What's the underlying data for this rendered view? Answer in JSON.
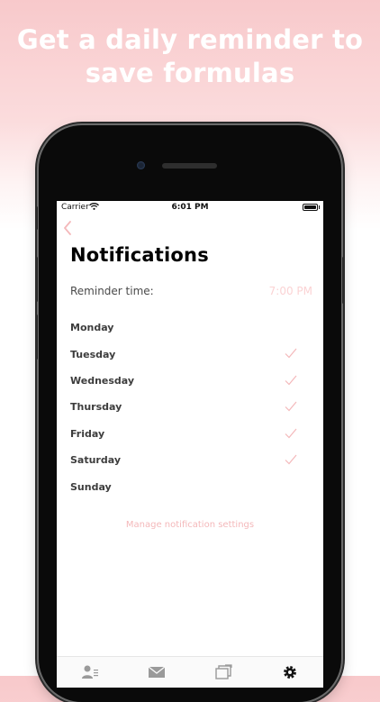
{
  "headline": {
    "line1": "Get a daily reminder to",
    "line2": "save formulas"
  },
  "status_bar": {
    "carrier": "Carrier",
    "time": "6:01 PM"
  },
  "nav": {
    "back_icon": "chevron-left-icon"
  },
  "page": {
    "title": "Notifications",
    "reminder_label": "Reminder time:",
    "reminder_value": "7:00 PM"
  },
  "days": [
    {
      "label": "Monday",
      "checked": false
    },
    {
      "label": "Tuesday",
      "checked": true
    },
    {
      "label": "Wednesday",
      "checked": true
    },
    {
      "label": "Thursday",
      "checked": true
    },
    {
      "label": "Friday",
      "checked": true
    },
    {
      "label": "Saturday",
      "checked": true
    },
    {
      "label": "Sunday",
      "checked": false
    }
  ],
  "manage_link": "Manage notification settings",
  "tabs": [
    {
      "icon": "contacts-icon",
      "selected": false
    },
    {
      "icon": "mail-icon",
      "selected": false
    },
    {
      "icon": "folders-icon",
      "selected": false
    },
    {
      "icon": "gear-icon",
      "selected": true
    }
  ],
  "colors": {
    "accent": "#f4b8ba",
    "accent_light": "#fbd3d4",
    "background_top": "#f8c9cb"
  }
}
